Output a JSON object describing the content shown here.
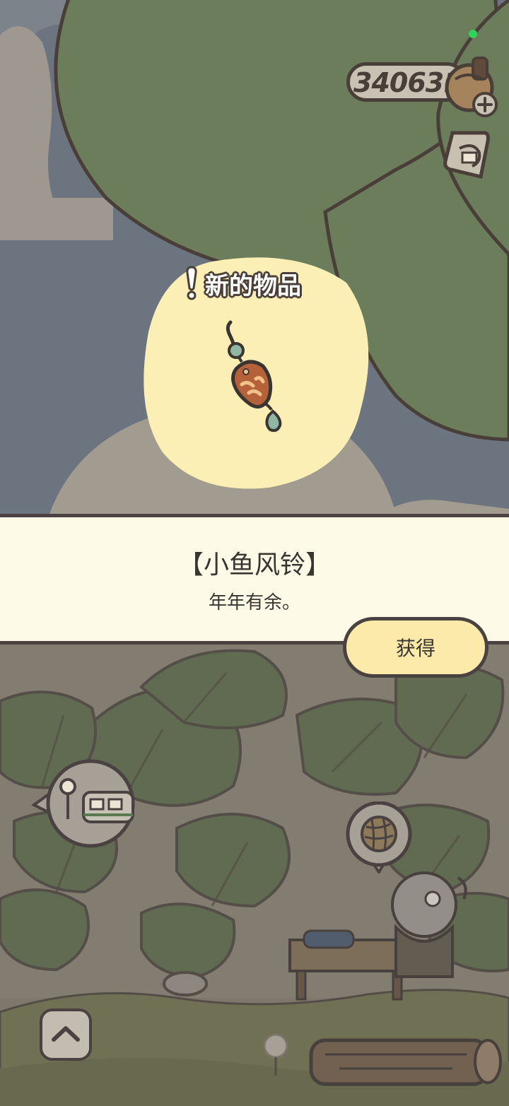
{
  "hud": {
    "clover_count": "340631"
  },
  "new_item": {
    "title": "新的物品",
    "name": "【小鱼风铃】",
    "description": "年年有余。"
  },
  "actions": {
    "obtain_label": "获得"
  },
  "icons": {
    "clover": "clover-icon",
    "add": "plus-icon",
    "ticket": "ticket-icon",
    "item": "fish-wind-chime-icon",
    "train": "train-speech-icon",
    "yarn": "yarn-ball-speech-icon",
    "up": "chevron-up-icon"
  },
  "colors": {
    "panel_bg": "#fefae8",
    "button_bg": "#fbeaaa",
    "outline": "#4a4240",
    "leaf": "#6b7d5b"
  }
}
